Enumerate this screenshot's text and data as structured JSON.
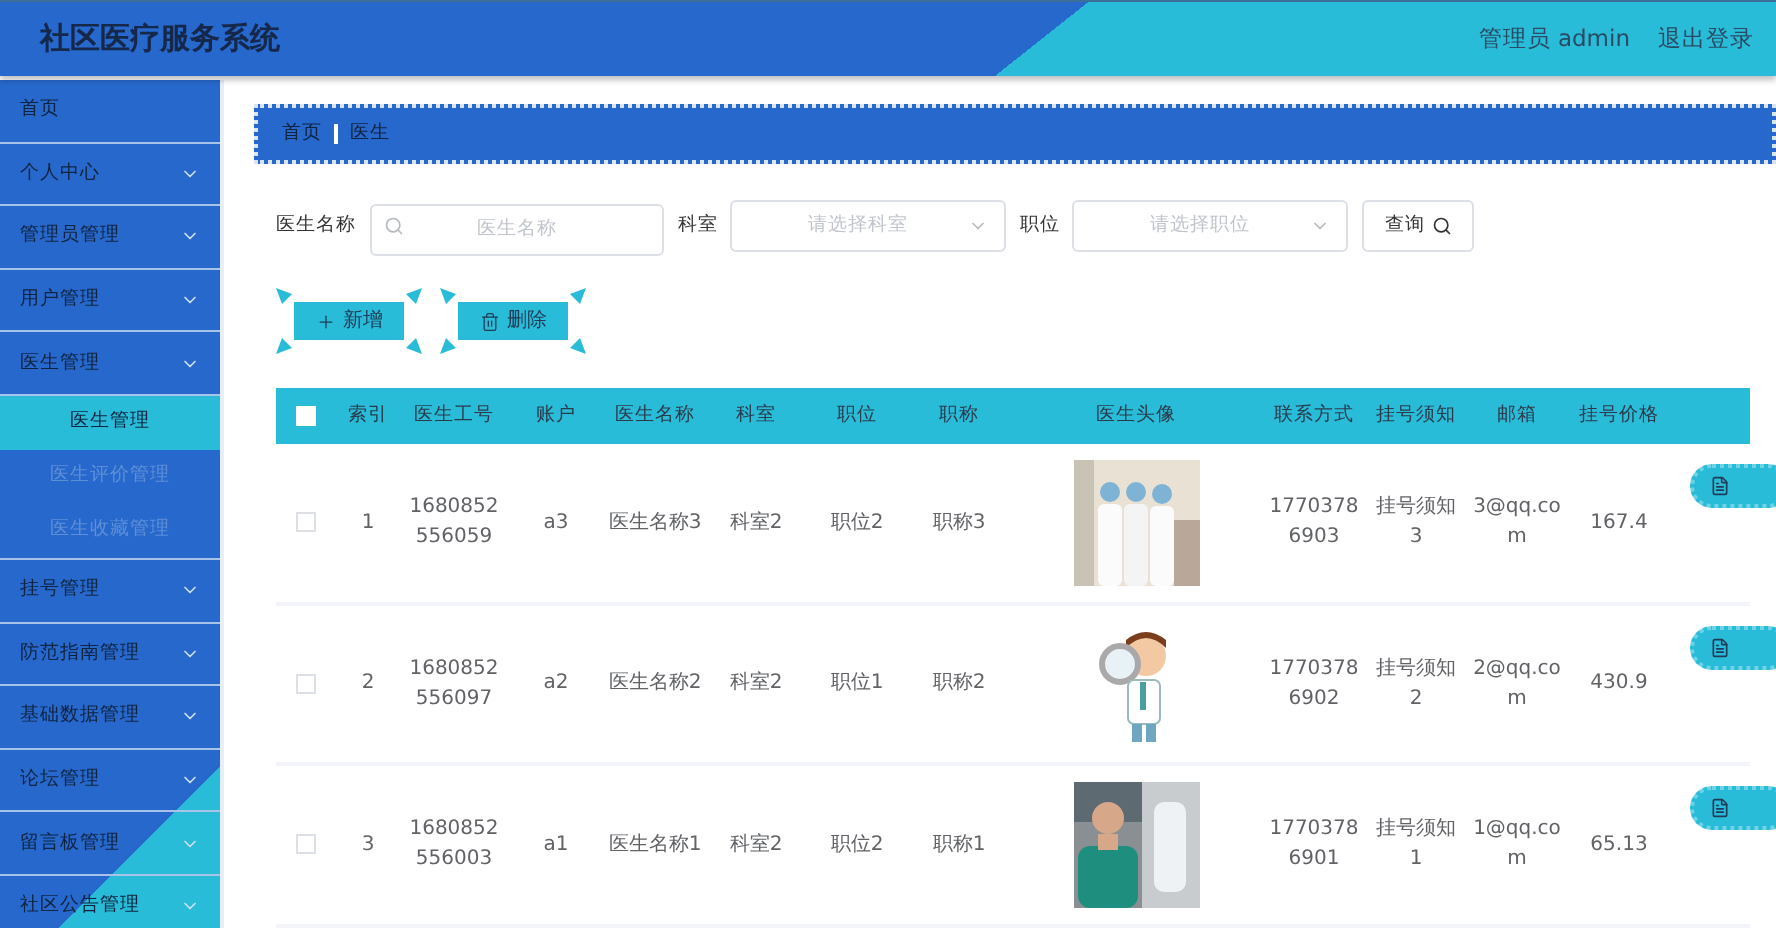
{
  "header": {
    "title": "社区医疗服务系统",
    "user": "管理员 admin",
    "logout": "退出登录"
  },
  "sidebar": {
    "items": [
      {
        "label": "首页",
        "kind": "link"
      },
      {
        "label": "个人中心",
        "kind": "menu"
      },
      {
        "label": "管理员管理",
        "kind": "menu"
      },
      {
        "label": "用户管理",
        "kind": "menu"
      },
      {
        "label": "医生管理",
        "kind": "menu",
        "children": [
          {
            "label": "医生管理",
            "selected": true
          },
          {
            "label": "医生评价管理",
            "selected": false
          },
          {
            "label": "医生收藏管理",
            "selected": false
          }
        ]
      },
      {
        "label": "挂号管理",
        "kind": "menu"
      },
      {
        "label": "防范指南管理",
        "kind": "menu"
      },
      {
        "label": "基础数据管理",
        "kind": "menu"
      },
      {
        "label": "论坛管理",
        "kind": "menu"
      },
      {
        "label": "留言板管理",
        "kind": "menu"
      },
      {
        "label": "社区公告管理",
        "kind": "menu"
      }
    ]
  },
  "breadcrumb": [
    "首页",
    "医生"
  ],
  "filters": [
    {
      "label": "医生名称",
      "kind": "input",
      "placeholder": "医生名称"
    },
    {
      "label": "科室",
      "kind": "select",
      "placeholder": "请选择科室"
    },
    {
      "label": "职位",
      "kind": "select",
      "placeholder": "请选择职位"
    }
  ],
  "search_button": "查询",
  "toolbar": [
    {
      "label": "新增",
      "kind": "add"
    },
    {
      "label": "删除",
      "kind": "delete"
    }
  ],
  "table": {
    "header_checkbox": {
      "checked": false
    },
    "columns": [
      "索引",
      "医生工号",
      "账户",
      "医生名称",
      "科室",
      "职位",
      "职称",
      "医生头像",
      "联系方式",
      "挂号须知",
      "邮箱",
      "挂号价格"
    ],
    "rows": [
      {
        "checked": false,
        "cells": [
          {
            "kind": "text",
            "text": "1"
          },
          {
            "kind": "text",
            "text": "1680852556059"
          },
          {
            "kind": "text",
            "text": "a3"
          },
          {
            "kind": "text",
            "text": "医生名称3"
          },
          {
            "kind": "text",
            "text": "科室2"
          },
          {
            "kind": "text",
            "text": "职位2"
          },
          {
            "kind": "text",
            "text": "职称3"
          },
          {
            "kind": "picture"
          },
          {
            "kind": "text",
            "text": "17703786903"
          },
          {
            "kind": "text",
            "text": "挂号须知3"
          },
          {
            "kind": "text",
            "text": "3@qq.com"
          },
          {
            "kind": "text",
            "text": "167.4"
          }
        ]
      },
      {
        "checked": false,
        "cells": [
          {
            "kind": "text",
            "text": "2"
          },
          {
            "kind": "text",
            "text": "1680852556097"
          },
          {
            "kind": "text",
            "text": "a2"
          },
          {
            "kind": "text",
            "text": "医生名称2"
          },
          {
            "kind": "text",
            "text": "科室2"
          },
          {
            "kind": "text",
            "text": "职位1"
          },
          {
            "kind": "text",
            "text": "职称2"
          },
          {
            "kind": "picture"
          },
          {
            "kind": "text",
            "text": "17703786902"
          },
          {
            "kind": "text",
            "text": "挂号须知2"
          },
          {
            "kind": "text",
            "text": "2@qq.com"
          },
          {
            "kind": "text",
            "text": "430.9"
          }
        ]
      },
      {
        "checked": false,
        "cells": [
          {
            "kind": "text",
            "text": "3"
          },
          {
            "kind": "text",
            "text": "1680852556003"
          },
          {
            "kind": "text",
            "text": "a1"
          },
          {
            "kind": "text",
            "text": "医生名称1"
          },
          {
            "kind": "text",
            "text": "科室2"
          },
          {
            "kind": "text",
            "text": "职位2"
          },
          {
            "kind": "text",
            "text": "职称1"
          },
          {
            "kind": "picture"
          },
          {
            "kind": "text",
            "text": "17703786901"
          },
          {
            "kind": "text",
            "text": "挂号须知1"
          },
          {
            "kind": "text",
            "text": "1@qq.com"
          },
          {
            "kind": "text",
            "text": "65.13"
          }
        ]
      }
    ]
  }
}
